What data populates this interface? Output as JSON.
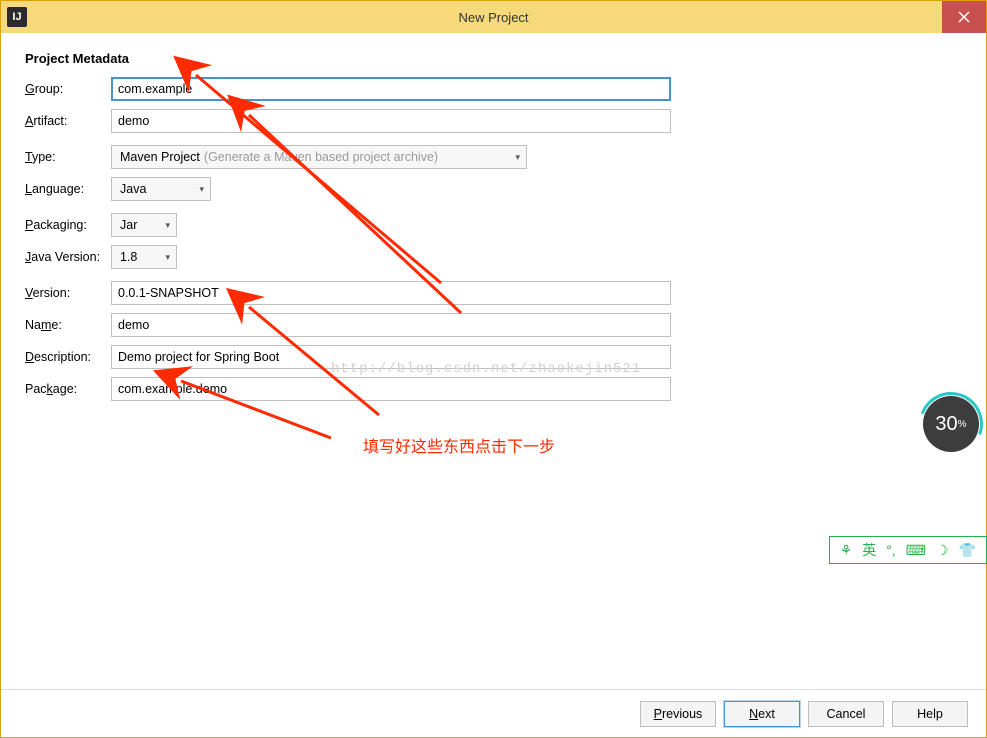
{
  "window": {
    "title": "New Project",
    "icon_text": "IJ"
  },
  "section_title": "Project Metadata",
  "fields": {
    "group": {
      "label": "Group:",
      "ul": "G",
      "value": "com.example"
    },
    "artifact": {
      "label": "Artifact:",
      "ul": "A",
      "value": "demo"
    },
    "type": {
      "label": "Type:",
      "ul": "T",
      "selected": "Maven Project",
      "hint": "(Generate a Maven based project archive)"
    },
    "language": {
      "label": "Language:",
      "ul": "L",
      "selected": "Java"
    },
    "packaging": {
      "label": "Packaging:",
      "ul": "P",
      "selected": "Jar"
    },
    "javaVersion": {
      "label": "Java Version:",
      "ul": "J",
      "selected": "1.8"
    },
    "version": {
      "label": "Version:",
      "ul": "V",
      "value": "0.0.1-SNAPSHOT"
    },
    "name": {
      "label": "Name:",
      "ul": "m",
      "prefix": "Na",
      "suffix": "e:",
      "value": "demo"
    },
    "description": {
      "label": "Description:",
      "ul": "D",
      "value": "Demo project for Spring Boot"
    },
    "package": {
      "label": "Package:",
      "ul": "k",
      "prefix": "Pac",
      "suffix": "age:",
      "value": "com.example.demo"
    }
  },
  "buttons": {
    "previous": "Previous",
    "next": "Next",
    "cancel": "Cancel",
    "help": "Help"
  },
  "annotations": {
    "note": "填写好这些东西点击下一步",
    "watermark": "http://blog.csdn.net/zhaokejin521"
  },
  "widget": {
    "percent": "30",
    "symbol": "%"
  },
  "ime": {
    "lang": "英"
  }
}
